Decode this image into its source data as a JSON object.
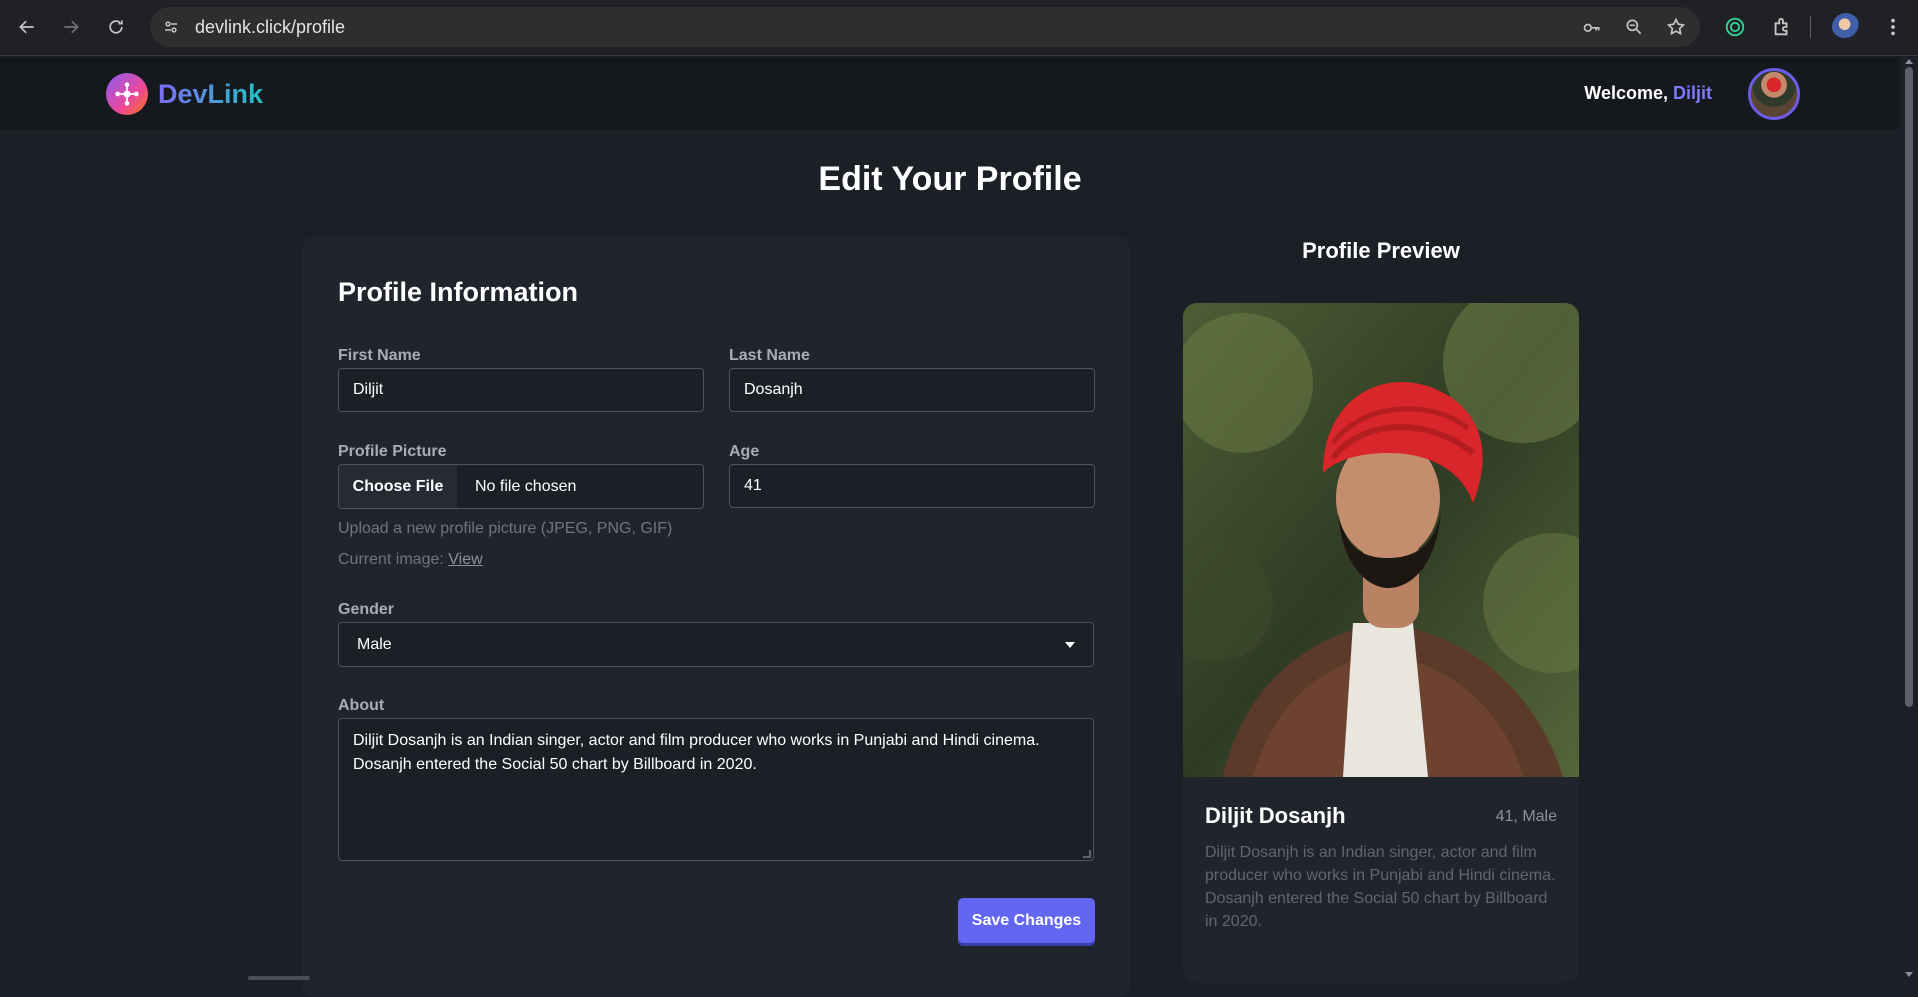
{
  "browser": {
    "url": "devlink.click/profile"
  },
  "header": {
    "brand": "DevLink",
    "welcome_prefix": "Welcome, ",
    "user_name": "Diljit"
  },
  "page": {
    "title": "Edit Your Profile"
  },
  "form": {
    "section_title": "Profile Information",
    "first_name": {
      "label": "First Name",
      "value": "Diljit"
    },
    "last_name": {
      "label": "Last Name",
      "value": "Dosanjh"
    },
    "profile_picture": {
      "label": "Profile Picture",
      "button": "Choose File",
      "status": "No file chosen",
      "hint": "Upload a new profile picture (JPEG, PNG, GIF)",
      "current_prefix": "Current image: ",
      "current_link": "View"
    },
    "age": {
      "label": "Age",
      "value": "41"
    },
    "gender": {
      "label": "Gender",
      "value": "Male"
    },
    "about": {
      "label": "About",
      "value": "Diljit Dosanjh is an Indian singer, actor and film producer who works in Punjabi and Hindi cinema. Dosanjh entered the Social 50 chart by Billboard in 2020."
    },
    "save_label": "Save Changes"
  },
  "preview": {
    "title": "Profile Preview",
    "name": "Diljit Dosanjh",
    "meta": "41, Male",
    "about": "Diljit Dosanjh is an Indian singer, actor and film producer who works in Punjabi and Hindi cinema. Dosanjh entered the Social 50 chart by Billboard in 2020."
  },
  "colors": {
    "accent": "#6366f1",
    "background": "#1b1f26",
    "card": "#20252d"
  }
}
